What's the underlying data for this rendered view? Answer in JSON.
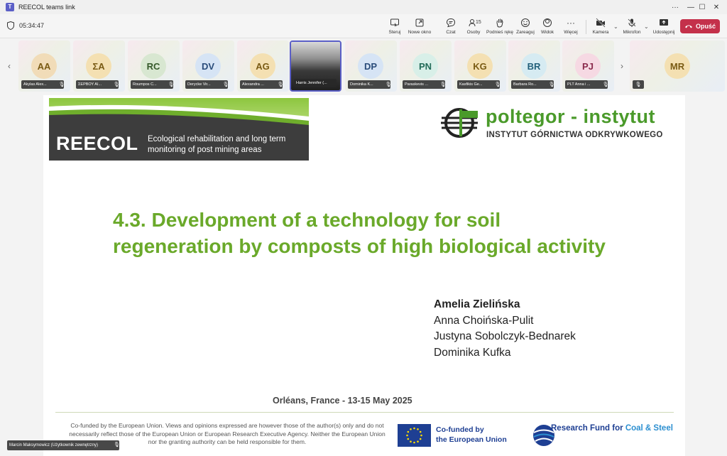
{
  "window": {
    "title": "REECOL teams link",
    "app_icon_glyph": "T",
    "minimize_glyph": "—",
    "maximize_glyph": "☐",
    "close_glyph": "✕"
  },
  "toolbar": {
    "timer": "05:34:47",
    "buttons": [
      {
        "label": "Steruj",
        "icon": "control-icon"
      },
      {
        "label": "Nowe okno",
        "icon": "new-window-icon"
      },
      {
        "label": "Czat",
        "icon": "chat-icon"
      },
      {
        "label": "Osoby",
        "icon": "people-icon",
        "badge": "15"
      },
      {
        "label": "Podnieś rękę",
        "icon": "raise-hand-icon"
      },
      {
        "label": "Zareaguj",
        "icon": "react-icon"
      },
      {
        "label": "Widok",
        "icon": "view-icon"
      },
      {
        "label": "Więcej",
        "icon": "more-icon"
      },
      {
        "label": "Kamera",
        "icon": "camera-off-icon"
      },
      {
        "label": "Mikrofon",
        "icon": "mic-off-icon"
      },
      {
        "label": "Udostępnij",
        "icon": "share-icon"
      }
    ],
    "leave_label": "Opuść",
    "leave_color": "#c4314b",
    "caret_glyph": "⌄"
  },
  "participants": [
    {
      "initials": "AA",
      "name": "Akylas Alex...",
      "bg": "#f1dcb8",
      "fg": "#7a5b14"
    },
    {
      "initials": "ΣΑ",
      "name": "ΣΕΡΒΟΥ ΑΙ...",
      "bg": "#f4e0b2",
      "fg": "#7a5b14"
    },
    {
      "initials": "RC",
      "name": "Roumpos C...",
      "bg": "#d8e7d1",
      "fg": "#35592a"
    },
    {
      "initials": "DV",
      "name": "Derycke Vir...",
      "bg": "#d6e4f5",
      "fg": "#2a4c7a"
    },
    {
      "initials": "AG",
      "name": "Alexandra ...",
      "bg": "#f4e0b2",
      "fg": "#7a5b14"
    },
    {
      "initials": "",
      "name": "Harris Jennifer (...",
      "photo": true
    },
    {
      "initials": "DP",
      "name": "Dominika K...",
      "bg": "#d6e4f5",
      "fg": "#2a4c7a"
    },
    {
      "initials": "PN",
      "name": "Paraskevis ...",
      "bg": "#d8efe8",
      "fg": "#226b58"
    },
    {
      "initials": "KG",
      "name": "Kasfikis Ge...",
      "bg": "#f4e0b2",
      "fg": "#7a5b14"
    },
    {
      "initials": "BR",
      "name": "Barbara Ro...",
      "bg": "#d6ebf2",
      "fg": "#22607a"
    },
    {
      "initials": "PJ",
      "name": "PLT Anna i ...",
      "bg": "#f6d9e3",
      "fg": "#8a2a4c"
    },
    {
      "initials": "MR",
      "name": "",
      "bg": "#f4e0b2",
      "fg": "#7a5b14"
    }
  ],
  "strip_nav": {
    "prev": "‹",
    "next": "›"
  },
  "mute_glyph": "🎙",
  "slide": {
    "banner_word": "REECOL",
    "banner_subtitle": "Ecological rehabilitation and long term monitoring of post mining areas",
    "poltegor_name": "poltegor - instytut",
    "poltegor_sub": "INSTYTUT GÓRNICTWA ODKRYWKOWEGO",
    "title": "4.3. Development of a technology for soil regeneration by composts of high biological activity",
    "authors_lead": "Amelia Zielińska",
    "authors": [
      "Anna Choińska-Pulit",
      "Justyna Sobolczyk-Bednarek",
      "Dominika Kufka"
    ],
    "event": "Orléans, France - 13-15 May 2025",
    "disclaimer": "Co-funded by the European Union. Views and opinions expressed are however those of the author(s) only and do not necessarily reflect those of the European Union or European Research Executive Agency. Neither the European Union nor the granting authority can be held responsible for them.",
    "eu_text_1": "Co-funded by",
    "eu_text_2": "the European Union",
    "rfcs_text_1": "Research Fund for",
    "rfcs_text_2": "Coal & Steel",
    "title_color": "#6aa92a",
    "accent_green": "#8dc63f",
    "eu_blue": "#1e3f93"
  },
  "self_view": {
    "name": "Marcin Maksymowicz (Użytkownik zewnętrzny)"
  }
}
